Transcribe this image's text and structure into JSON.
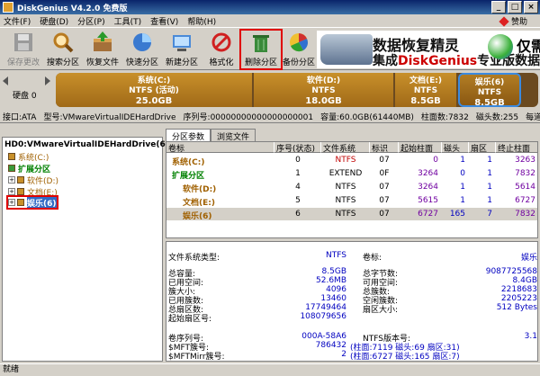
{
  "app": {
    "title": "DiskGenius V4.2.0 免费版"
  },
  "menu": [
    "文件(F)",
    "硬盘(D)",
    "分区(P)",
    "工具(T)",
    "查看(V)",
    "帮助(H)"
  ],
  "help_link": "赞助",
  "toolbar": {
    "save": "保存更改",
    "search": "搜索分区",
    "recover": "恢复文件",
    "format_fast": "快速分区",
    "new_part": "新建分区",
    "format": "格式化",
    "delete": "删除分区",
    "backup": "备份分区"
  },
  "banner": {
    "line1": "数据恢复精灵",
    "line2_prefix": "集成",
    "line2_brand": "DiskGenius",
    "line2_suffix": "专业版数据恢",
    "right": "仅需"
  },
  "diskmap": {
    "label": "硬盘 0",
    "parts": [
      {
        "name": "系统(C:)",
        "fs": "NTFS (活动)",
        "size": "25.0GB"
      },
      {
        "name": "软件(D:)",
        "fs": "NTFS",
        "size": "18.0GB"
      },
      {
        "name": "文档(E:)",
        "fs": "NTFS",
        "size": "8.5GB"
      },
      {
        "name": "娱乐(6)",
        "fs": "NTFS",
        "size": "8.5GB"
      }
    ]
  },
  "diskinfo": [
    "接口:ATA",
    "型号:VMwareVirtualIDEHardDrive",
    "序列号:00000000000000000001",
    "容量:60.0GB(61440MB)",
    "柱面数:7832",
    "磁头数:255",
    "每道扇区"
  ],
  "tree": {
    "root": "HD0:VMwareVirtualIDEHardDrive(6",
    "items": [
      "系统(C:)",
      "扩展分区",
      "软件(D:)",
      "文档(E:)",
      "娱乐(6)"
    ]
  },
  "tabs": [
    "分区参数",
    "浏览文件"
  ],
  "table": {
    "headers": [
      "卷标",
      "序号(状态)",
      "文件系统",
      "标识",
      "起始柱面",
      "磁头",
      "扇区",
      "终止柱面"
    ],
    "rows": [
      {
        "name": "系统(C:)",
        "no": "0",
        "fs": "NTFS",
        "id": "07",
        "start": "0",
        "head": "1",
        "sec": "1",
        "end": "3263"
      },
      {
        "name": "扩展分区",
        "no": "1",
        "fs": "EXTEND",
        "id": "0F",
        "start": "3264",
        "head": "0",
        "sec": "1",
        "end": "7832"
      },
      {
        "name": "软件(D:)",
        "no": "4",
        "fs": "NTFS",
        "id": "07",
        "start": "3264",
        "head": "1",
        "sec": "1",
        "end": "5614"
      },
      {
        "name": "文档(E:)",
        "no": "5",
        "fs": "NTFS",
        "id": "07",
        "start": "5615",
        "head": "1",
        "sec": "1",
        "end": "6727"
      },
      {
        "name": "娱乐(6)",
        "no": "6",
        "fs": "NTFS",
        "id": "07",
        "start": "6727",
        "head": "165",
        "sec": "7",
        "end": "7832"
      }
    ]
  },
  "detail": {
    "fs_type_label": "文件系统类型:",
    "fs_type": "NTFS",
    "vol_label": "卷标:",
    "vol": "娱乐",
    "left": [
      [
        "总容量:",
        "8.5GB"
      ],
      [
        "已用空间:",
        "52.6MB"
      ],
      [
        "簇大小:",
        "4096"
      ],
      [
        "已用簇数:",
        "13460"
      ],
      [
        "总扇区数:",
        "17749464"
      ],
      [
        "起始扇区号:",
        "108079656"
      ]
    ],
    "right": [
      [
        "总字节数:",
        "9087725568"
      ],
      [
        "可用空间:",
        "8.4GB"
      ],
      [
        "总簇数:",
        "2218683"
      ],
      [
        "空闲簇数:",
        "2205223"
      ],
      [
        "扇区大小:",
        "512 Bytes"
      ]
    ],
    "bottom_left": [
      [
        "卷序列号:",
        "000A-58A6"
      ],
      [
        "$MFT簇号:",
        "786432"
      ],
      [
        "$MFTMirr簇号:",
        "2"
      ]
    ],
    "bottom_right": [
      [
        "NTFS版本号:",
        "3.1"
      ],
      [
        "",
        "(柱面:7119 磁头:69 扇区:31)"
      ],
      [
        "",
        "(柱面:6727 磁头:165 扇区:7)"
      ]
    ]
  },
  "status": "就绪"
}
